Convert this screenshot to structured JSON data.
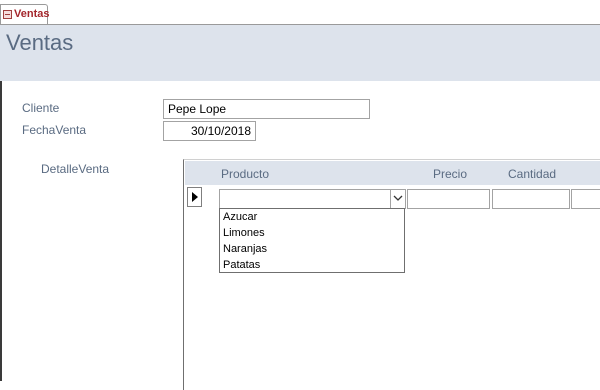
{
  "tab": {
    "label": "Ventas",
    "icon": "form-icon"
  },
  "header": {
    "title": "Ventas"
  },
  "form": {
    "cliente_label": "Cliente",
    "cliente_value": "Pepe Lope",
    "fecha_label": "FechaVenta",
    "fecha_value": "30/10/2018",
    "detalle_label": "DetalleVenta"
  },
  "subform": {
    "columns": [
      "Producto",
      "Precio",
      "Cantidad"
    ],
    "producto_value": "",
    "precio_value": "",
    "cantidad_value": "",
    "dropdown_options": [
      "Azucar",
      "Limones",
      "Naranjas",
      "Patatas"
    ]
  },
  "colors": {
    "header_band": "#dde3ec",
    "label_text": "#5a6b82",
    "tab_text": "#a4262c"
  }
}
